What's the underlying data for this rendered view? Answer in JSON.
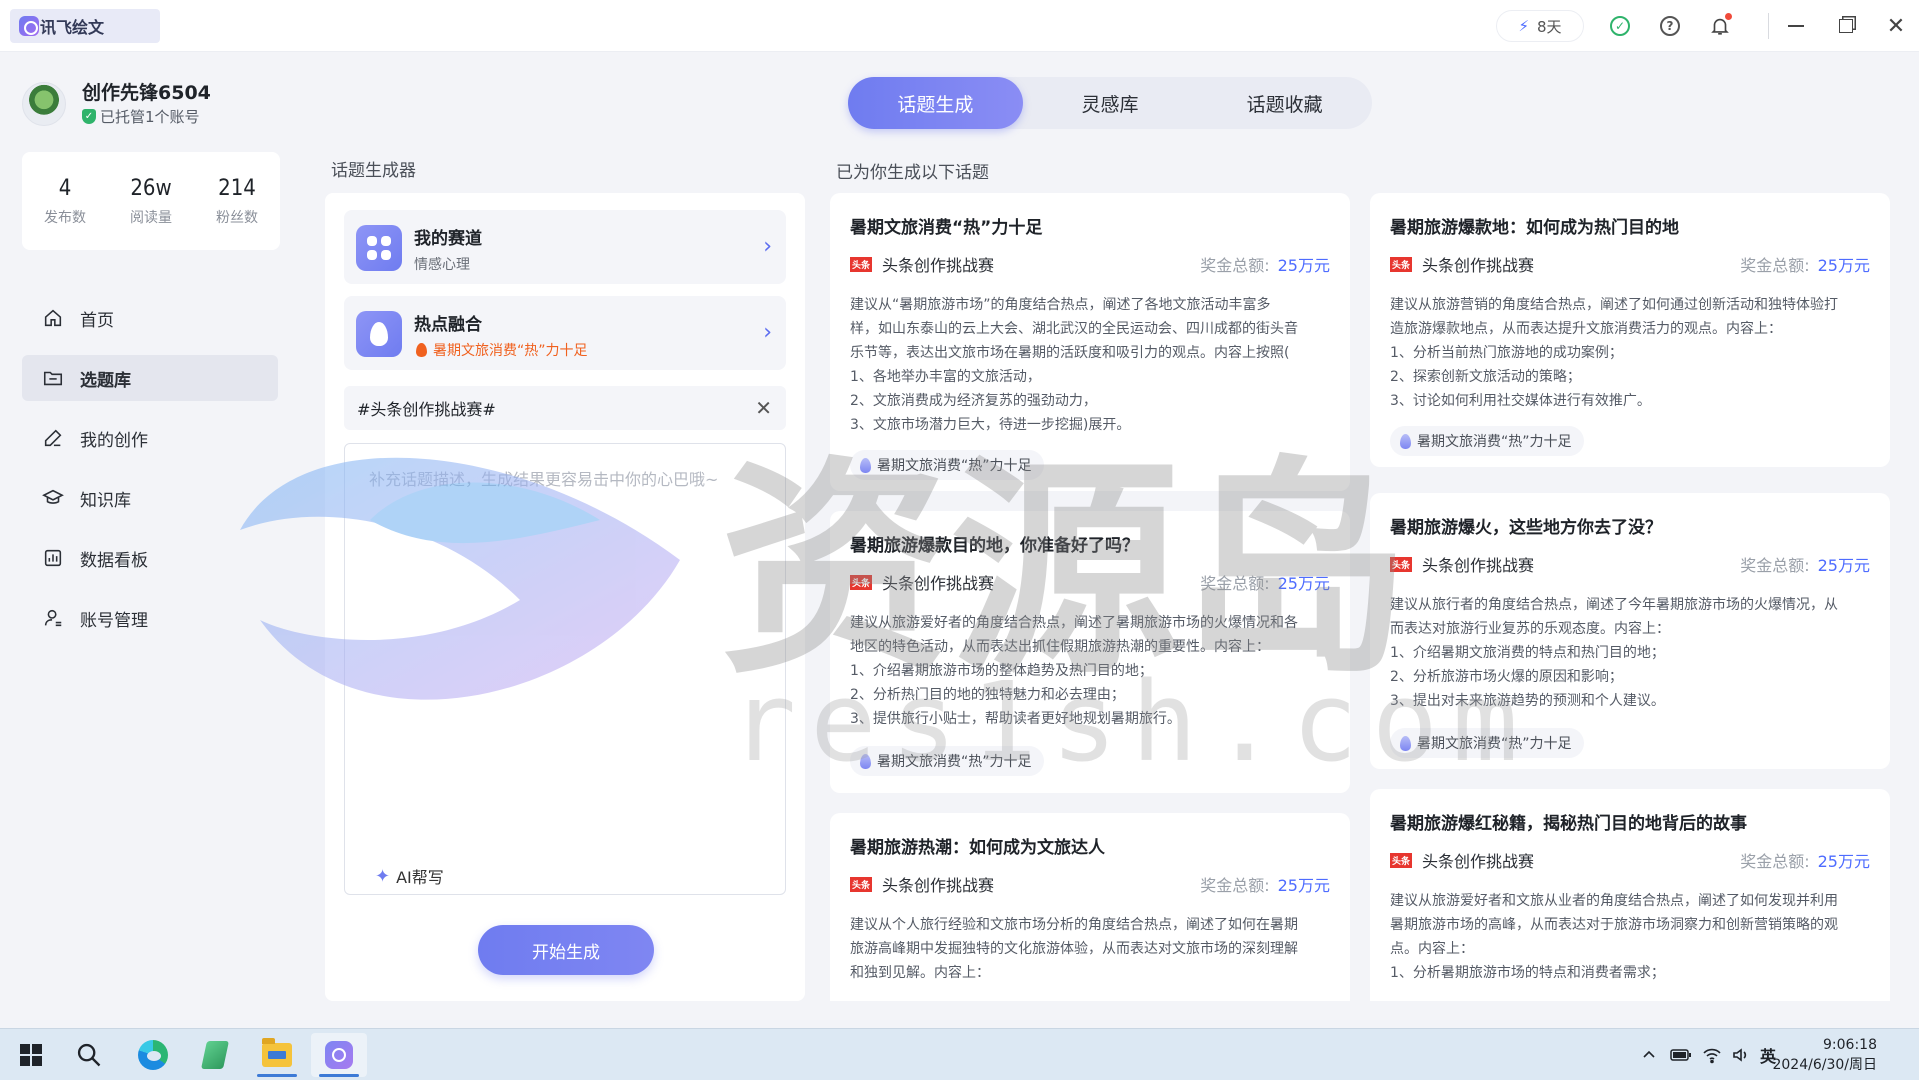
{
  "app": {
    "name": "讯飞绘文"
  },
  "titlebar": {
    "vip_days": "8天"
  },
  "profile": {
    "name": "创作先锋6504",
    "status": "已托管1个账号"
  },
  "stats": [
    {
      "value": "4",
      "label": "发布数"
    },
    {
      "value": "26w",
      "label": "阅读量"
    },
    {
      "value": "214",
      "label": "粉丝数"
    }
  ],
  "nav": [
    {
      "label": "首页",
      "icon": "home-icon"
    },
    {
      "label": "选题库",
      "icon": "folder-icon"
    },
    {
      "label": "我的创作",
      "icon": "pen-icon"
    },
    {
      "label": "知识库",
      "icon": "graduation-cap-icon"
    },
    {
      "label": "数据看板",
      "icon": "chart-icon"
    },
    {
      "label": "账号管理",
      "icon": "user-icon"
    }
  ],
  "tabs": [
    "话题生成",
    "灵感库",
    "话题收藏"
  ],
  "generator": {
    "title": "话题生成器",
    "track": {
      "title": "我的赛道",
      "value": "情感心理"
    },
    "hot": {
      "title": "热点融合",
      "value": "暑期文旅消费“热”力十足"
    },
    "tag_value": "#头条创作挑战赛#",
    "desc_placeholder": "补充话题描述，生成结果更容易击中你的心巴哦~",
    "ai_help": "AI帮写",
    "start_button": "开始生成"
  },
  "results": {
    "title": "已为你生成以下话题",
    "source_logo": "头条",
    "cards": [
      {
        "title": "暑期文旅消费“热”力十足",
        "contest": "头条创作挑战赛",
        "prize_label": "奖金总额:",
        "prize_amount": "25万元",
        "lines": [
          "建议从“暑期旅游市场”的角度结合热点，阐述了各地文旅活动丰富多",
          "样，如山东泰山的云上大会、湖北武汉的全民运动会、四川成都的街头音",
          "乐节等，表达出文旅市场在暑期的活跃度和吸引力的观点。内容上按照(",
          "1、各地举办丰富的文旅活动，",
          "2、文旅消费成为经济复苏的强劲动力，",
          "3、文旅市场潜力巨大，待进一步挖掘)展开。"
        ],
        "chip": "暑期文旅消费“热”力十足"
      },
      {
        "title": "暑期旅游爆款地：如何成为热门目的地",
        "contest": "头条创作挑战赛",
        "prize_label": "奖金总额:",
        "prize_amount": "25万元",
        "lines": [
          "建议从旅游营销的角度结合热点，阐述了如何通过创新活动和独特体验打",
          "造旅游爆款地点，从而表达提升文旅消费活力的观点。内容上：",
          "1、分析当前热门旅游地的成功案例；",
          "2、探索创新文旅活动的策略；",
          "3、讨论如何利用社交媒体进行有效推广。"
        ],
        "chip": "暑期文旅消费“热”力十足"
      },
      {
        "title": "暑期旅游爆款目的地，你准备好了吗？",
        "contest": "头条创作挑战赛",
        "prize_label": "奖金总额:",
        "prize_amount": "25万元",
        "lines": [
          "建议从旅游爱好者的角度结合热点，阐述了暑期旅游市场的火爆情况和各",
          "地区的特色活动，从而表达出抓住假期旅游热潮的重要性。内容上：",
          "1、介绍暑期旅游市场的整体趋势及热门目的地；",
          "2、分析热门目的地的独特魅力和必去理由；",
          "3、提供旅行小贴士，帮助读者更好地规划暑期旅行。"
        ],
        "chip": "暑期文旅消费“热”力十足"
      },
      {
        "title": "暑期旅游爆火，这些地方你去了没？",
        "contest": "头条创作挑战赛",
        "prize_label": "奖金总额:",
        "prize_amount": "25万元",
        "lines": [
          "建议从旅行者的角度结合热点，阐述了今年暑期旅游市场的火爆情况，从",
          "而表达对旅游行业复苏的乐观态度。内容上：",
          "1、介绍暑期文旅消费的特点和热门目的地；",
          "2、分析旅游市场火爆的原因和影响；",
          "3、提出对未来旅游趋势的预测和个人建议。"
        ],
        "chip": "暑期文旅消费“热”力十足"
      },
      {
        "title": "暑期旅游热潮：如何成为文旅达人",
        "contest": "头条创作挑战赛",
        "prize_label": "奖金总额:",
        "prize_amount": "25万元",
        "lines": [
          "建议从个人旅行经验和文旅市场分析的角度结合热点，阐述了如何在暑期",
          "旅游高峰期中发掘独特的文化旅游体验，从而表达对文旅市场的深刻理解",
          "和独到见解。内容上："
        ]
      },
      {
        "title": "暑期旅游爆红秘籍，揭秘热门目的地背后的故事",
        "contest": "头条创作挑战赛",
        "prize_label": "奖金总额:",
        "prize_amount": "25万元",
        "lines": [
          "建议从旅游爱好者和文旅从业者的角度结合热点，阐述了如何发现并利用",
          "暑期旅游市场的高峰，从而表达对于旅游市场洞察力和创新营销策略的观",
          "点。内容上：",
          "1、分析暑期旅游市场的特点和消费者需求；"
        ]
      }
    ]
  },
  "watermark": {
    "text": "资源岛",
    "url_text": "res1sh.com"
  },
  "taskbar": {
    "ime": "英",
    "time": "9:06:18",
    "date": "2024/6/30/周日"
  }
}
